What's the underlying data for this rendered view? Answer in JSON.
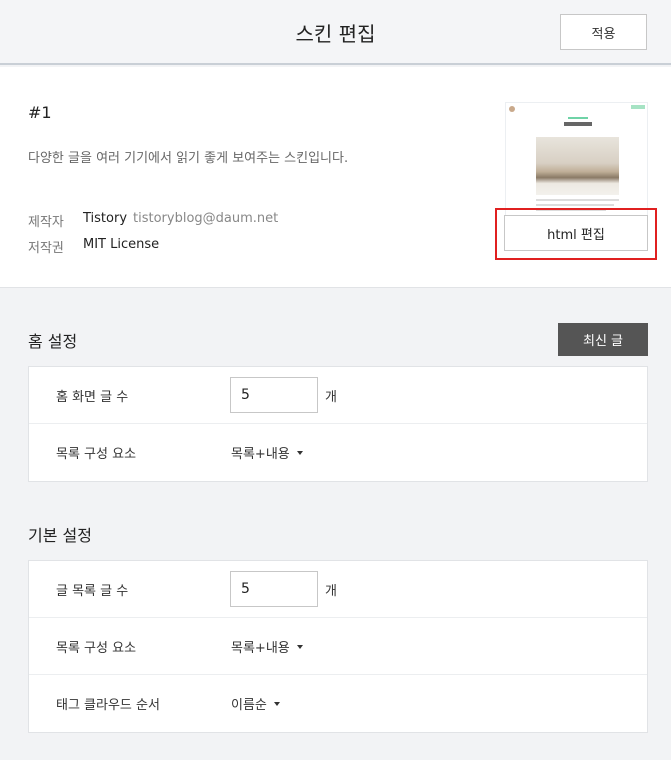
{
  "header": {
    "title": "스킨 편집",
    "apply_label": "적용"
  },
  "skin": {
    "number": "#1",
    "description": "다양한 글을 여러 기기에서 읽기 좋게 보여주는 스킨입니다.",
    "author_key": "제작자",
    "author_name": "Tistory",
    "author_email": "tistoryblog@daum.net",
    "license_key": "저작권",
    "license_value": "MIT License",
    "html_edit_label": "html 편집"
  },
  "home": {
    "title": "홈 설정",
    "recent_label": "최신 글",
    "rows": [
      {
        "label": "홈 화면 글 수",
        "value": "5",
        "unit": "개"
      },
      {
        "label": "목록 구성 요소",
        "select": "목록+내용"
      }
    ]
  },
  "basic": {
    "title": "기본 설정",
    "rows": [
      {
        "label": "글 목록 글 수",
        "value": "5",
        "unit": "개"
      },
      {
        "label": "목록 구성 요소",
        "select": "목록+내용"
      },
      {
        "label": "태그 클라우드 순서",
        "select": "이름순"
      }
    ]
  }
}
